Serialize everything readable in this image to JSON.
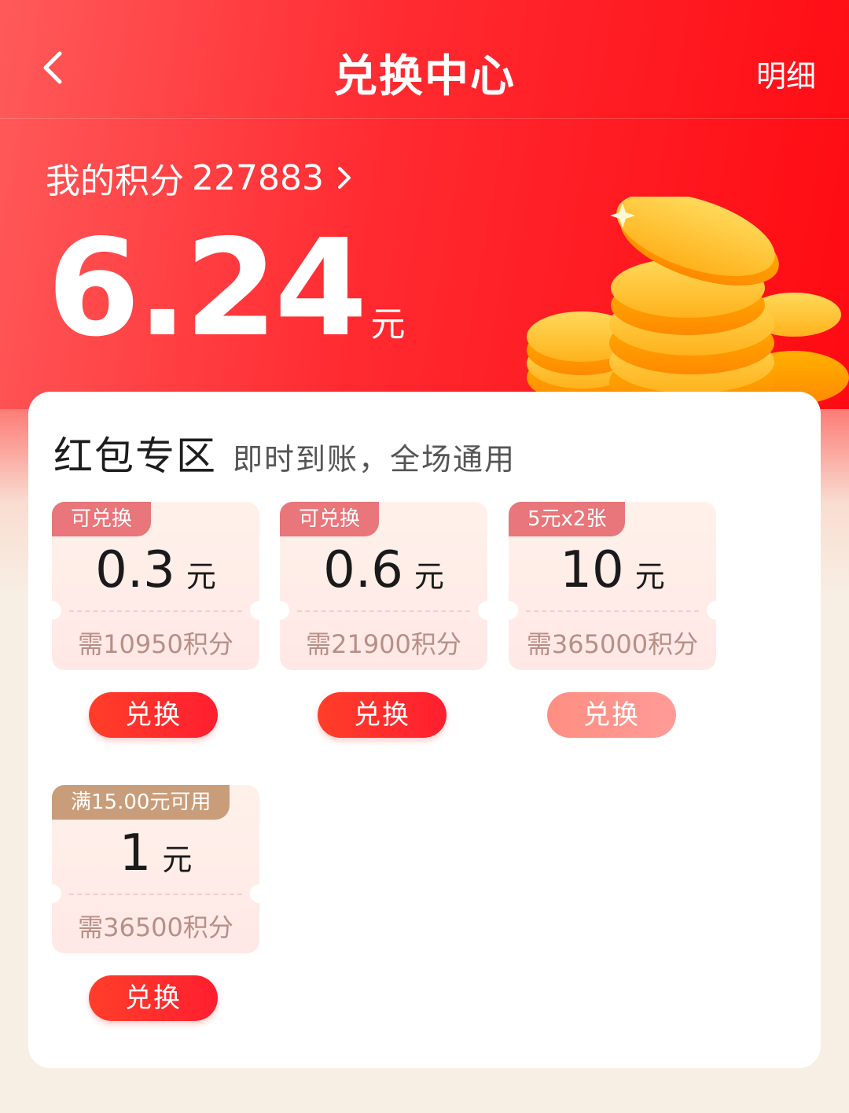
{
  "nav": {
    "title": "兑换中心",
    "detail_label": "明细"
  },
  "points": {
    "label": "我的积分",
    "value": "227883"
  },
  "balance": {
    "amount": "6.24",
    "unit": "元"
  },
  "section": {
    "title": "红包专区",
    "subtitle": "即时到账，全场通用"
  },
  "coupons": [
    {
      "tag": "可兑换",
      "value": "0.3",
      "unit": "元",
      "need": "需10950积分",
      "button": "兑换",
      "enabled": true
    },
    {
      "tag": "可兑换",
      "value": "0.6",
      "unit": "元",
      "need": "需21900积分",
      "button": "兑换",
      "enabled": true
    },
    {
      "tag": "5元x2张",
      "value": "10",
      "unit": "元",
      "need": "需365000积分",
      "button": "兑换",
      "enabled": false
    },
    {
      "tag": "满15.00元可用",
      "value": "1",
      "unit": "元",
      "need": "需36500积分",
      "button": "兑换",
      "enabled": true
    }
  ],
  "colors": {
    "primary": "#ff2a2a",
    "tag_red": "#e8767a",
    "tag_brown": "#c99d7a",
    "button_disabled": "#ff9b97"
  },
  "icons": [
    "chevron-left-icon",
    "chevron-right-icon",
    "gold-coins-illustration"
  ]
}
